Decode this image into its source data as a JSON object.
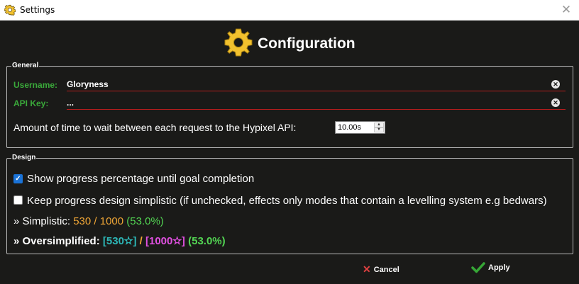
{
  "window": {
    "title": "Settings",
    "close_glyph": "✕"
  },
  "header": {
    "title": "Configuration",
    "icon": "gear-icon"
  },
  "general": {
    "legend": "General",
    "username_label": "Username:",
    "username_value": "Gloryness",
    "apikey_label": "API Key:",
    "apikey_value": "...",
    "wait_label": "Amount of time to wait between each request to the Hypixel API:",
    "wait_value": "10.00s"
  },
  "design": {
    "legend": "Design",
    "show_progress_label": "Show progress percentage until goal completion",
    "show_progress_checked": true,
    "simplistic_label": "Keep progress design simplistic (if unchecked, effects only modes that contain a levelling system e.g bedwars)",
    "simplistic_checked": false,
    "simplistic_preview": {
      "prefix": "» Simplistic:",
      "fraction": "530 / 1000",
      "percent": "(53.0%)"
    },
    "oversimplified_preview": {
      "prefix": "» Oversimplified:",
      "current": "[530✫]",
      "separator": "/",
      "goal": "[1000✫]",
      "percent": "(53.0%)"
    }
  },
  "footer": {
    "cancel_label": "Cancel",
    "apply_label": "Apply"
  },
  "colors": {
    "background": "#1a1a18",
    "label_green": "#3aa93a",
    "underline_red": "#b51d1d",
    "orange": "#f0a636",
    "percent_green": "#53d553",
    "teal": "#2db6b6",
    "pink": "#e050e0",
    "cancel_red": "#e04141",
    "apply_green": "#36a636",
    "gear_yellow": "#f2c12e"
  }
}
